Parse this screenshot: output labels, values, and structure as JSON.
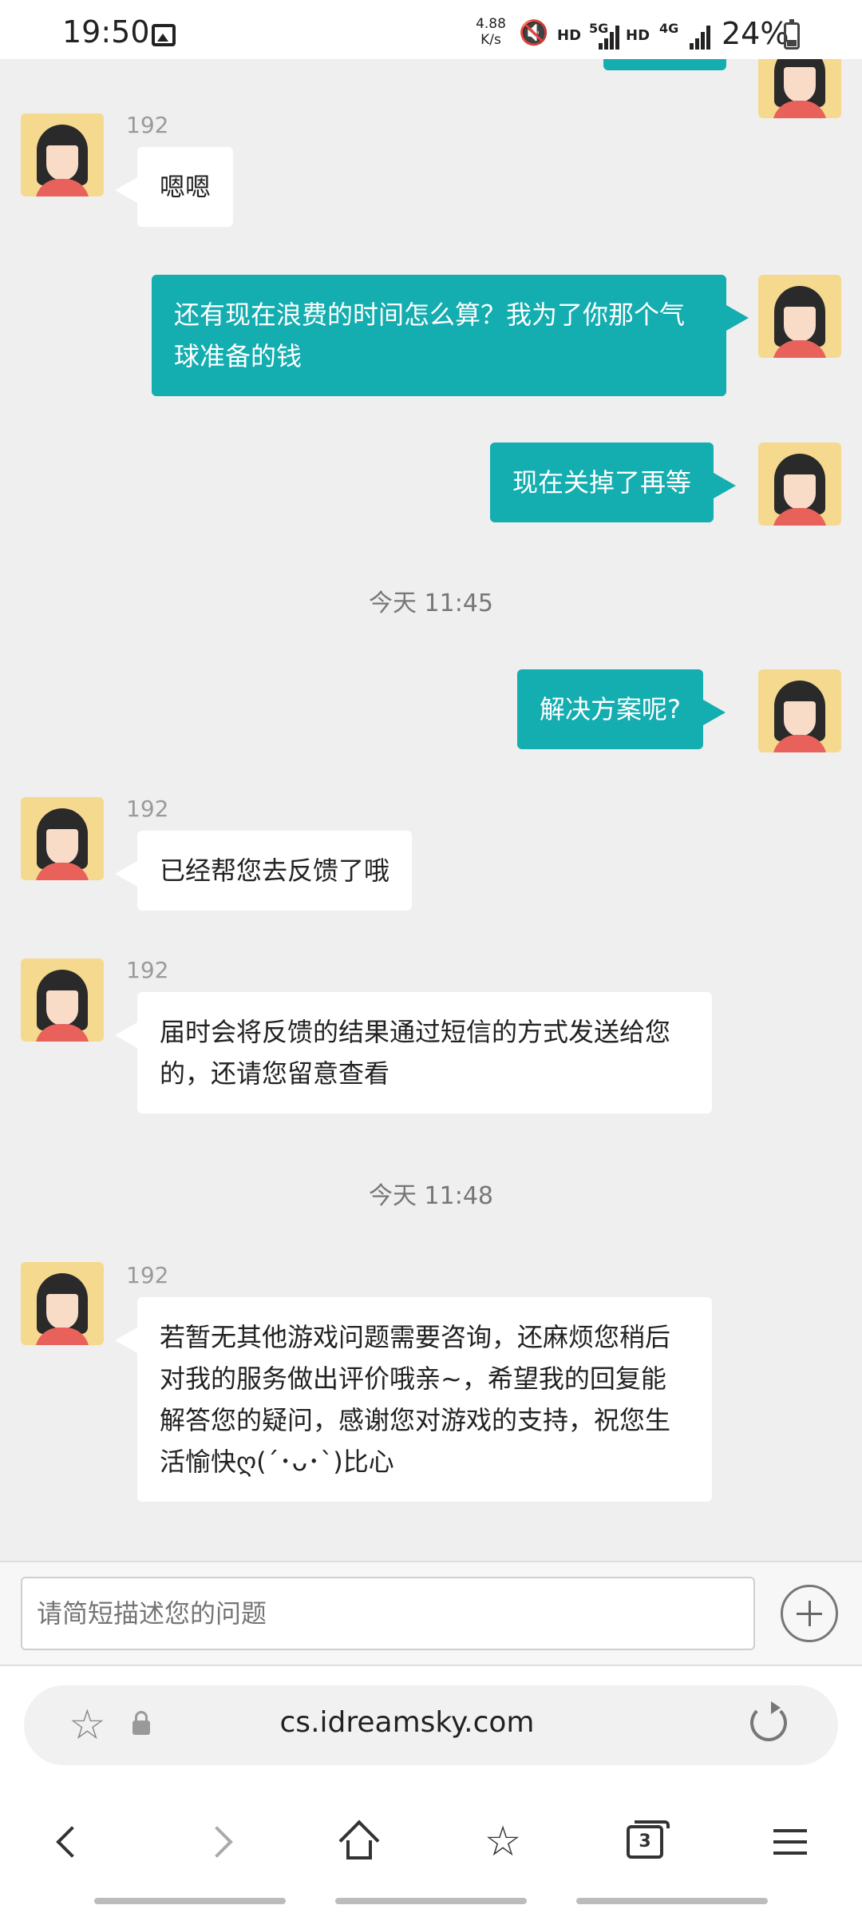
{
  "status_bar": {
    "time": "19:50",
    "net_speed": "4.88",
    "net_speed_unit": "K/s",
    "hd1": "HD",
    "net1": "5G",
    "hd2": "HD",
    "net2": "4G",
    "battery": "24%"
  },
  "chat": {
    "messages": [
      {
        "side": "in",
        "sender": "192",
        "text": "嗯嗯"
      },
      {
        "side": "out",
        "text": "还有现在浪费的时间怎么算？我为了你那个气球准备的钱"
      },
      {
        "side": "out",
        "text": "现在关掉了再等"
      },
      {
        "side": "out",
        "text": "解决方案呢?"
      },
      {
        "side": "in",
        "sender": "192",
        "text": "已经帮您去反馈了哦"
      },
      {
        "side": "in",
        "sender": "192",
        "text": "届时会将反馈的结果通过短信的方式发送给您的，还请您留意查看"
      },
      {
        "side": "in",
        "sender": "192",
        "text": "若暂无其他游戏问题需要咨询，还麻烦您稍后对我的服务做出评价哦亲~，希望我的回复能解答您的疑问，感谢您对游戏的支持，祝您生活愉快ღ(´･ᴗ･`)比心"
      }
    ],
    "timestamps": [
      "今天 11:45",
      "今天 11:48"
    ]
  },
  "input": {
    "placeholder": "请简短描述您的问题",
    "value": ""
  },
  "browser": {
    "url": "cs.idreamsky.com",
    "tab_count": "3"
  },
  "colors": {
    "outgoing_bubble": "#14adb0",
    "incoming_bubble": "#ffffff",
    "background": "#efefef"
  },
  "icons": [
    "gallery-icon",
    "mute-icon",
    "battery-icon",
    "star-icon",
    "lock-icon",
    "reload-icon",
    "back-icon",
    "forward-icon",
    "home-icon",
    "bookmarks-icon",
    "tabs-icon",
    "menu-icon",
    "plus-icon"
  ]
}
